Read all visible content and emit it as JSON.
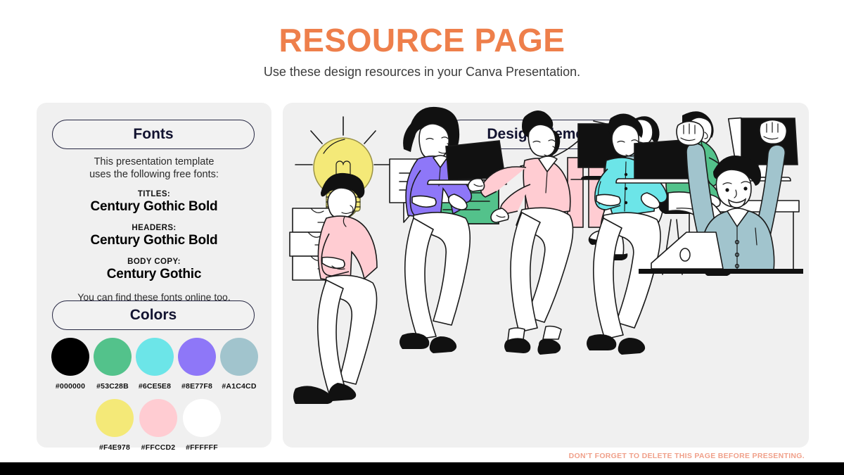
{
  "header": {
    "title": "RESOURCE PAGE",
    "subtitle": "Use these design resources in your Canva Presentation.",
    "title_color": "#EE7F4B"
  },
  "fonts_panel": {
    "pill_label": "Fonts",
    "intro_line1": "This presentation template",
    "intro_line2": "uses the following free fonts:",
    "categories": [
      {
        "label": "TITLES:",
        "font": "Century Gothic Bold"
      },
      {
        "label": "HEADERS:",
        "font": "Century Gothic Bold"
      },
      {
        "label": "BODY COPY:",
        "font": "Century Gothic"
      }
    ],
    "outro": "You can find these fonts online too."
  },
  "colors_panel": {
    "pill_label": "Colors",
    "row1": [
      {
        "hex": "#000000",
        "label": "#000000"
      },
      {
        "hex": "#53C28B",
        "label": "#53C28B"
      },
      {
        "hex": "#6CE5E8",
        "label": "#6CE5E8"
      },
      {
        "hex": "#8E77F8",
        "label": "#8E77F8"
      },
      {
        "hex": "#A1C4CD",
        "label": "#A1C4CD"
      }
    ],
    "row2": [
      {
        "hex": "#F4E978",
        "label": "#F4E978"
      },
      {
        "hex": "#FFCCD2",
        "label": "#FFCCD2"
      },
      {
        "hex": "#FFFFFF",
        "label": "#FFFFFF"
      }
    ]
  },
  "design_panel": {
    "pill_label": "Design Elements",
    "elements": [
      {
        "name": "lightbulb-illustration",
        "description": "Yellow lightbulb with rays",
        "color": "#F4E978"
      },
      {
        "name": "speech-bubbles-illustration",
        "description": "White and green chat bubbles",
        "color": "#53C28B"
      },
      {
        "name": "bar-chart-illustration",
        "description": "Ascending pink bar chart with arrow",
        "color": "#FFCCD2"
      },
      {
        "name": "person-at-monitor-illustration",
        "description": "Person in blue-gray sitting at monitor",
        "color": "#A1C4CD"
      },
      {
        "name": "person-green-at-desk-illustration",
        "description": "Person in green at desk with monitor",
        "color": "#53C28B"
      },
      {
        "name": "person-carrying-boxes-illustration",
        "description": "Person in pink carrying stacked boxes",
        "color": "#FFCCD2"
      },
      {
        "name": "woman-with-laptop-illustration",
        "description": "Woman in purple holding a laptop",
        "color": "#8E77F8"
      },
      {
        "name": "woman-gesturing-illustration",
        "description": "Woman in pink with outstretched arms",
        "color": "#FFCCD2"
      },
      {
        "name": "man-with-laptop-illustration",
        "description": "Man in cyan shirt holding a laptop",
        "color": "#6CE5E8"
      },
      {
        "name": "celebrating-person-illustration",
        "description": "Person in blue-gray cheering behind laptop",
        "color": "#A1C4CD"
      }
    ]
  },
  "footer": {
    "note": "DON'T FORGET TO DELETE THIS PAGE BEFORE PRESENTING.",
    "note_color": "#F0A08A",
    "bar_color": "#000000"
  }
}
